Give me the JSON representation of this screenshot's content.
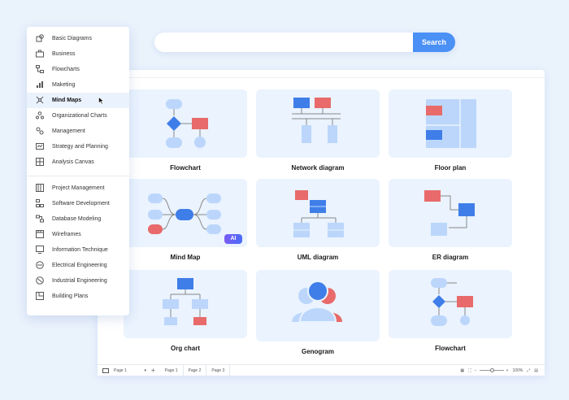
{
  "search": {
    "placeholder": "",
    "button_label": "Search"
  },
  "sidebar": {
    "group1": [
      {
        "label": "Basic Diagrams",
        "icon": "shapes-icon"
      },
      {
        "label": "Business",
        "icon": "briefcase-icon"
      },
      {
        "label": "Flowcharts",
        "icon": "flowchart-icon"
      },
      {
        "label": "Maketing",
        "icon": "bar-chart-icon"
      },
      {
        "label": "Mind Maps",
        "icon": "mind-map-icon",
        "active": true
      },
      {
        "label": "Organizational Charts",
        "icon": "org-chart-icon"
      },
      {
        "label": "Management",
        "icon": "management-icon"
      },
      {
        "label": "Strategy and Planning",
        "icon": "strategy-icon"
      },
      {
        "label": "Analysis Canvas",
        "icon": "canvas-icon"
      }
    ],
    "group2": [
      {
        "label": "Project Management",
        "icon": "gantt-icon"
      },
      {
        "label": "Software Development",
        "icon": "software-icon"
      },
      {
        "label": "Database Modeling",
        "icon": "database-icon"
      },
      {
        "label": "Wireframes",
        "icon": "wireframe-icon"
      },
      {
        "label": "Information Technique",
        "icon": "info-tech-icon"
      },
      {
        "label": "Electrical Engineering",
        "icon": "electrical-icon"
      },
      {
        "label": "Industrial Engineering",
        "icon": "industrial-icon"
      },
      {
        "label": "Building Plans",
        "icon": "building-icon"
      }
    ]
  },
  "cards": {
    "c1": "Flowchart",
    "c2": "Network diagram",
    "c3": "Floor plan",
    "c4": "Mind Map",
    "c5": "UML diagram",
    "c6": "ER diagram",
    "c7": "Org chart",
    "c8": "Genogram",
    "c9": "Flowchart",
    "ai_badge": "AI"
  },
  "bottom_bar": {
    "page_select": "Page 1",
    "add": "+",
    "tabs": [
      "Page 1",
      "Page 2",
      "Page 3"
    ],
    "zoom": "100%"
  },
  "colors": {
    "accent": "#4a90f5",
    "shape_blue": "#3f7ee8",
    "shape_red": "#e86a6a",
    "shape_light": "#bcd6fb"
  }
}
